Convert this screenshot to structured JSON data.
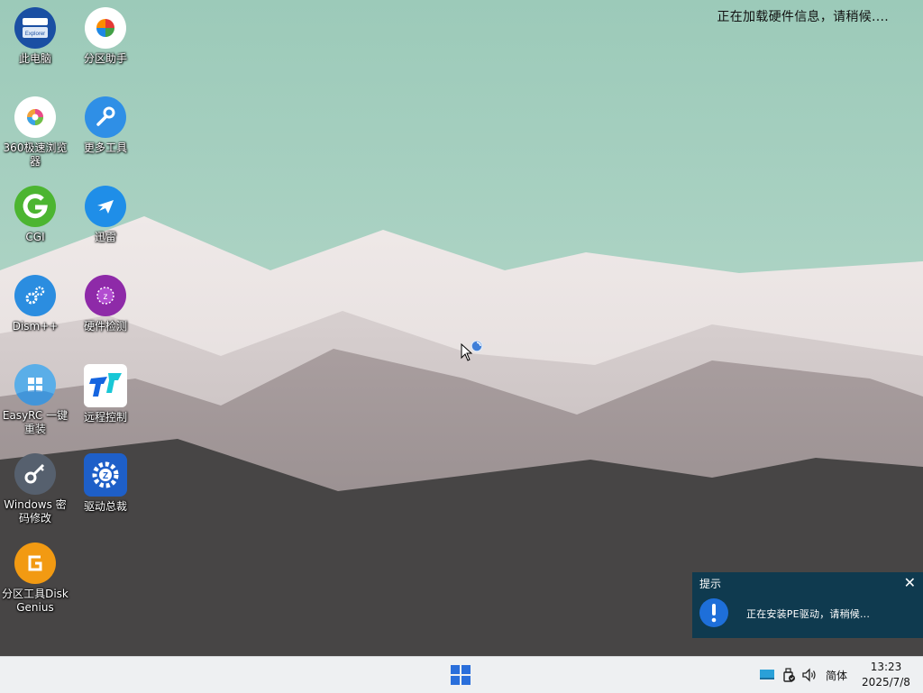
{
  "status": "正在加载硬件信息，请稍候....",
  "icons": [
    {
      "label": "此电脑",
      "icon": "explorer-icon"
    },
    {
      "label": "分区助手",
      "icon": "partition-assistant-icon"
    },
    {
      "label": "360极速浏览器",
      "icon": "360-browser-icon"
    },
    {
      "label": "更多工具",
      "icon": "wrench-icon"
    },
    {
      "label": "CGI",
      "icon": "cgi-icon"
    },
    {
      "label": "迅雷",
      "icon": "thunder-icon"
    },
    {
      "label": "Dism++",
      "icon": "dism-gear-icon"
    },
    {
      "label": "硬件检测",
      "icon": "hardware-detect-icon"
    },
    {
      "label": "EasyRC 一键重装",
      "icon": "windows-logo-icon"
    },
    {
      "label": "远程控制",
      "icon": "remote-control-icon"
    },
    {
      "label": "Windows 密码修改",
      "icon": "key-icon"
    },
    {
      "label": "驱动总裁",
      "icon": "driver-gear-icon"
    },
    {
      "label": "分区工具DiskGenius",
      "icon": "diskgenius-icon"
    }
  ],
  "explorer_badge": "Explorer",
  "toast": {
    "title": "提示",
    "message": "正在安装PE驱动，请稍候...",
    "close": "✕"
  },
  "taskbar": {
    "ime": "简体",
    "time": "13:23",
    "date": "2025/7/8"
  },
  "colors": {
    "sky": "#a8cfc0",
    "toast_bg": "#0f3a4f",
    "taskbar_bg": "#eef0f2",
    "accent": "#1e6fd9"
  }
}
